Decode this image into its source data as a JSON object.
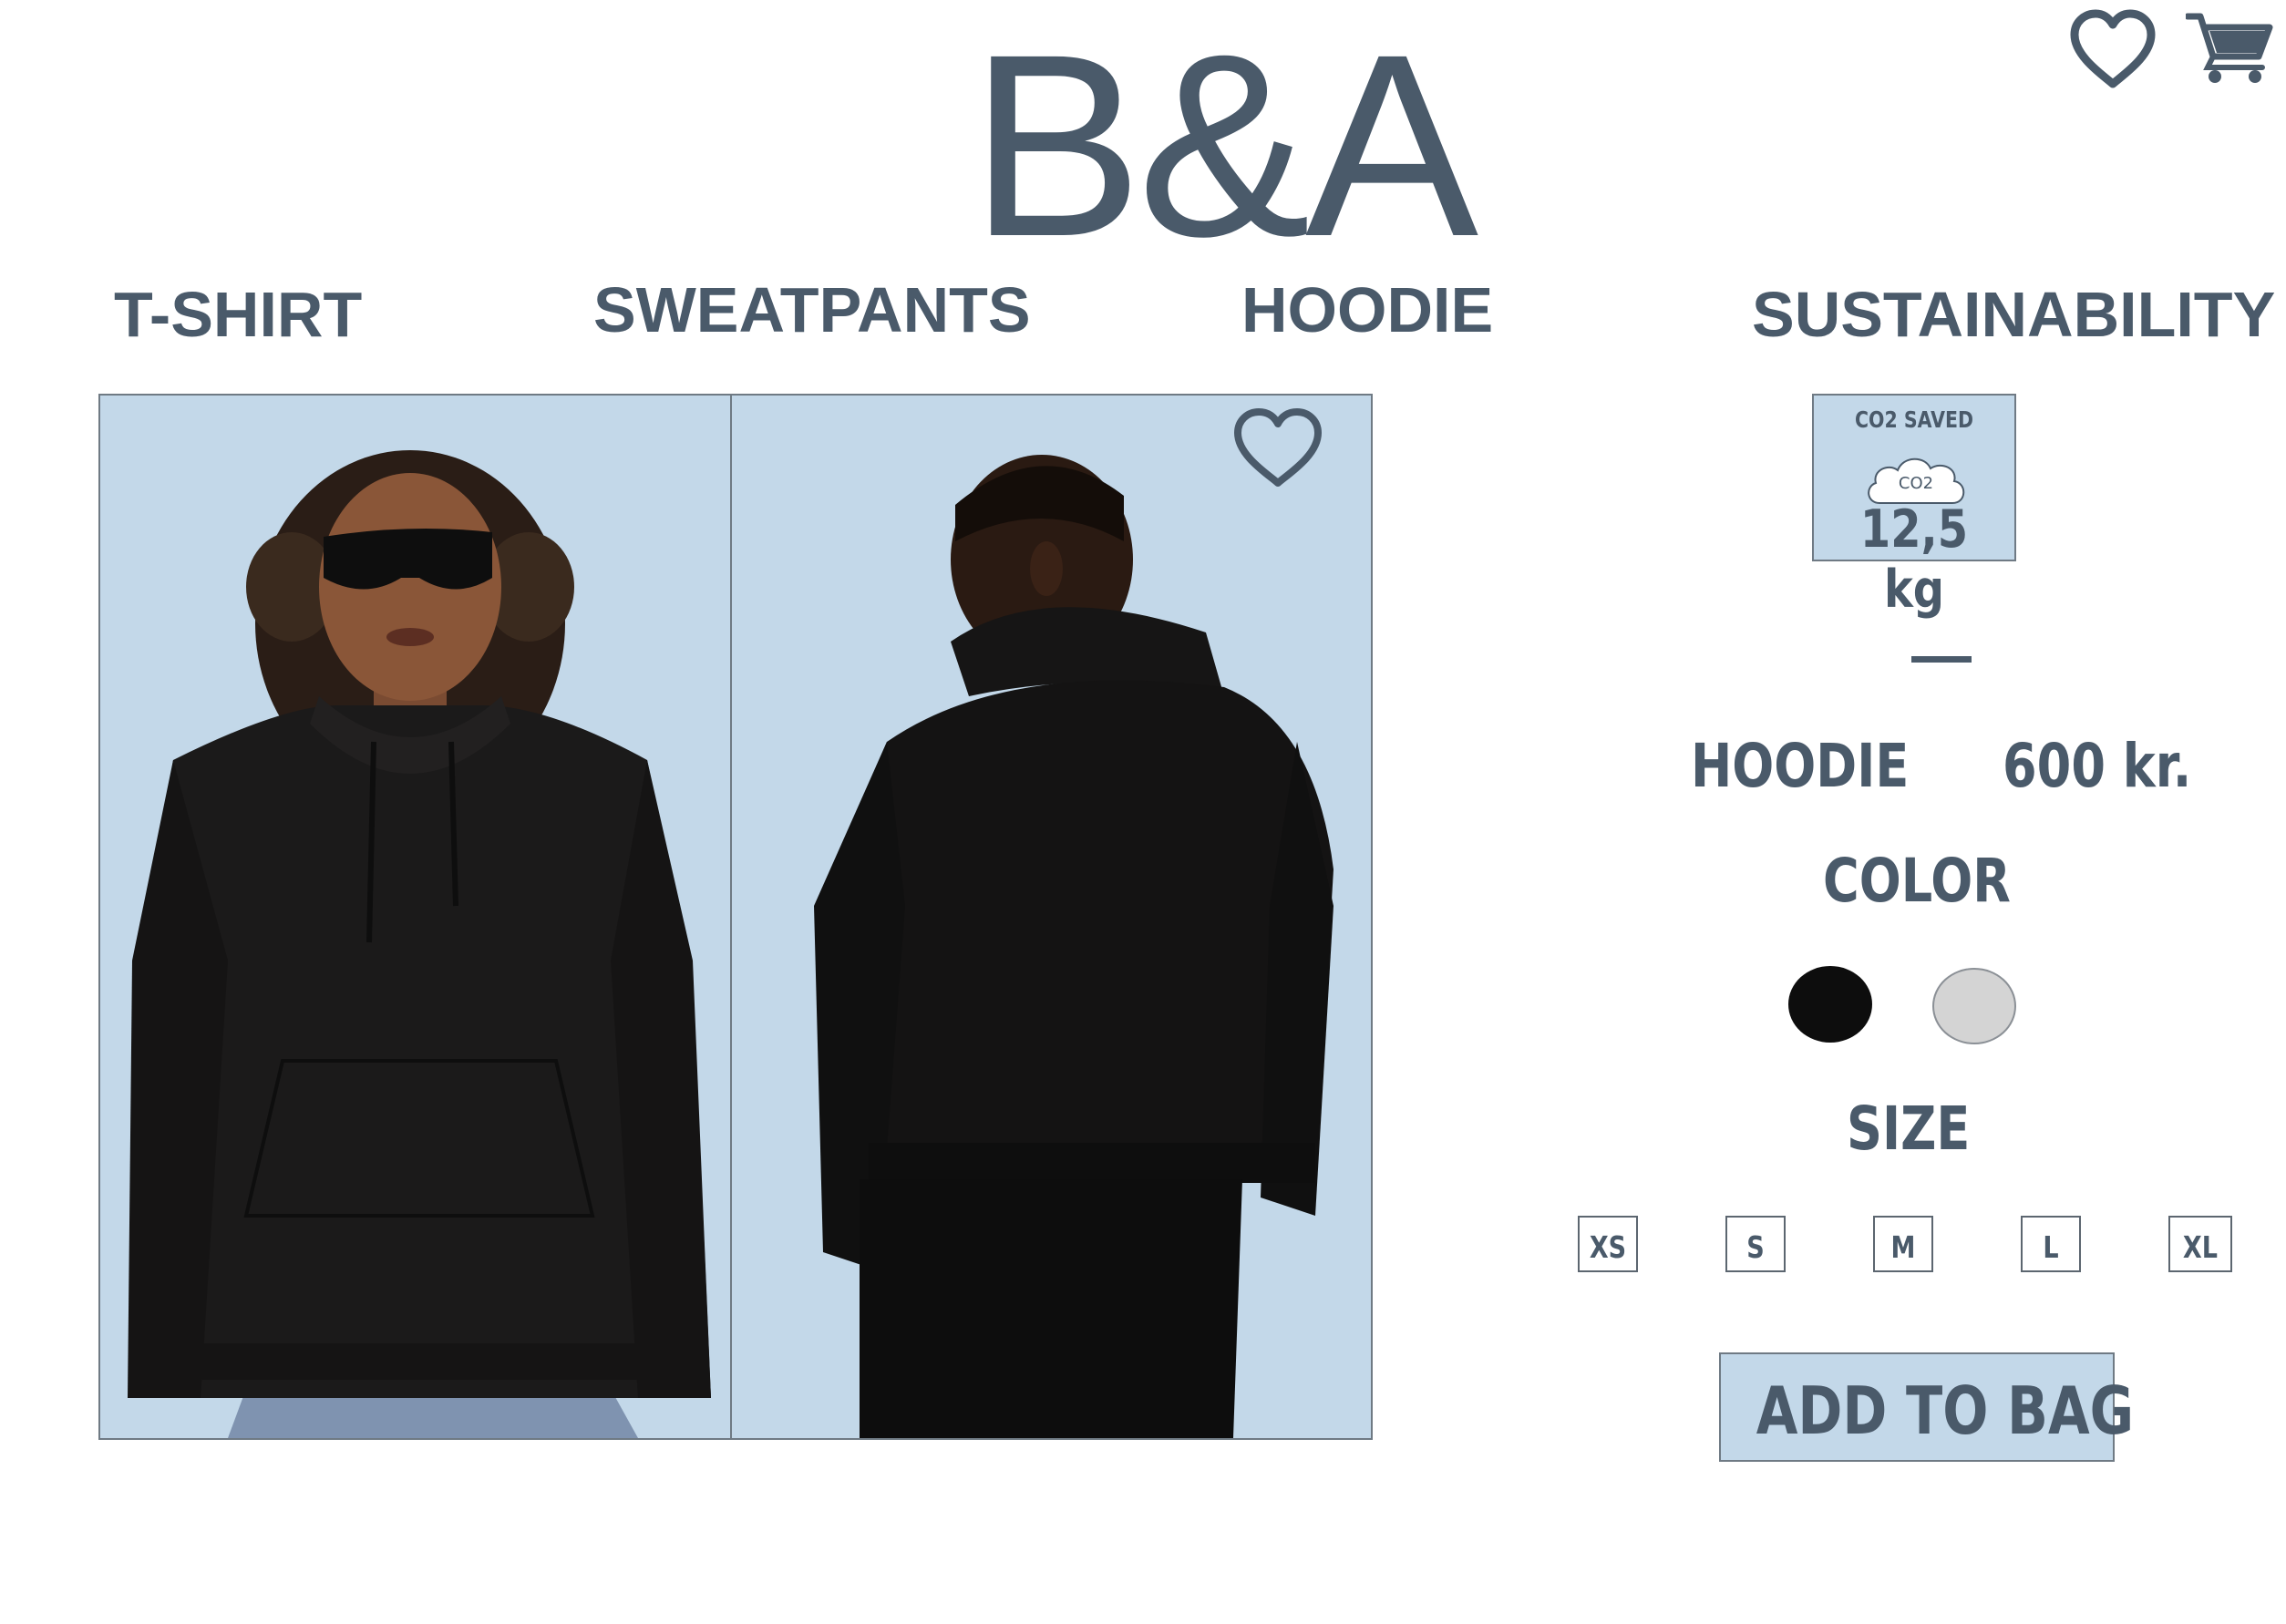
{
  "brand": {
    "logo_text": "B&A"
  },
  "header": {
    "icons": [
      "heart-icon",
      "shopping-cart-icon"
    ]
  },
  "nav": {
    "items": [
      {
        "label": "T-SHIRT"
      },
      {
        "label": "SWEATPANTS"
      },
      {
        "label": "HOODIE"
      },
      {
        "label": "SUSTAINABILITY"
      }
    ]
  },
  "gallery": {
    "photos": [
      "front-view-photo",
      "back-view-photo"
    ],
    "wishlist_icon": "heart-icon"
  },
  "co2": {
    "title": "CO2 SAVED",
    "cloud_text": "CO2",
    "value": "12,5 kg"
  },
  "product": {
    "name": "HOODIE",
    "price": "600 kr.",
    "color_label": "COLOR",
    "colors": [
      {
        "name": "black",
        "hex": "#0d0d0d"
      },
      {
        "name": "light-grey",
        "hex": "#d4d4d4"
      }
    ],
    "size_label": "SIZE",
    "sizes": [
      "XS",
      "S",
      "M",
      "L",
      "XL"
    ],
    "add_to_bag_label": "ADD TO BAG"
  },
  "theme": {
    "text": "#4a5a6a",
    "accent_bg": "#c3d8e9"
  }
}
